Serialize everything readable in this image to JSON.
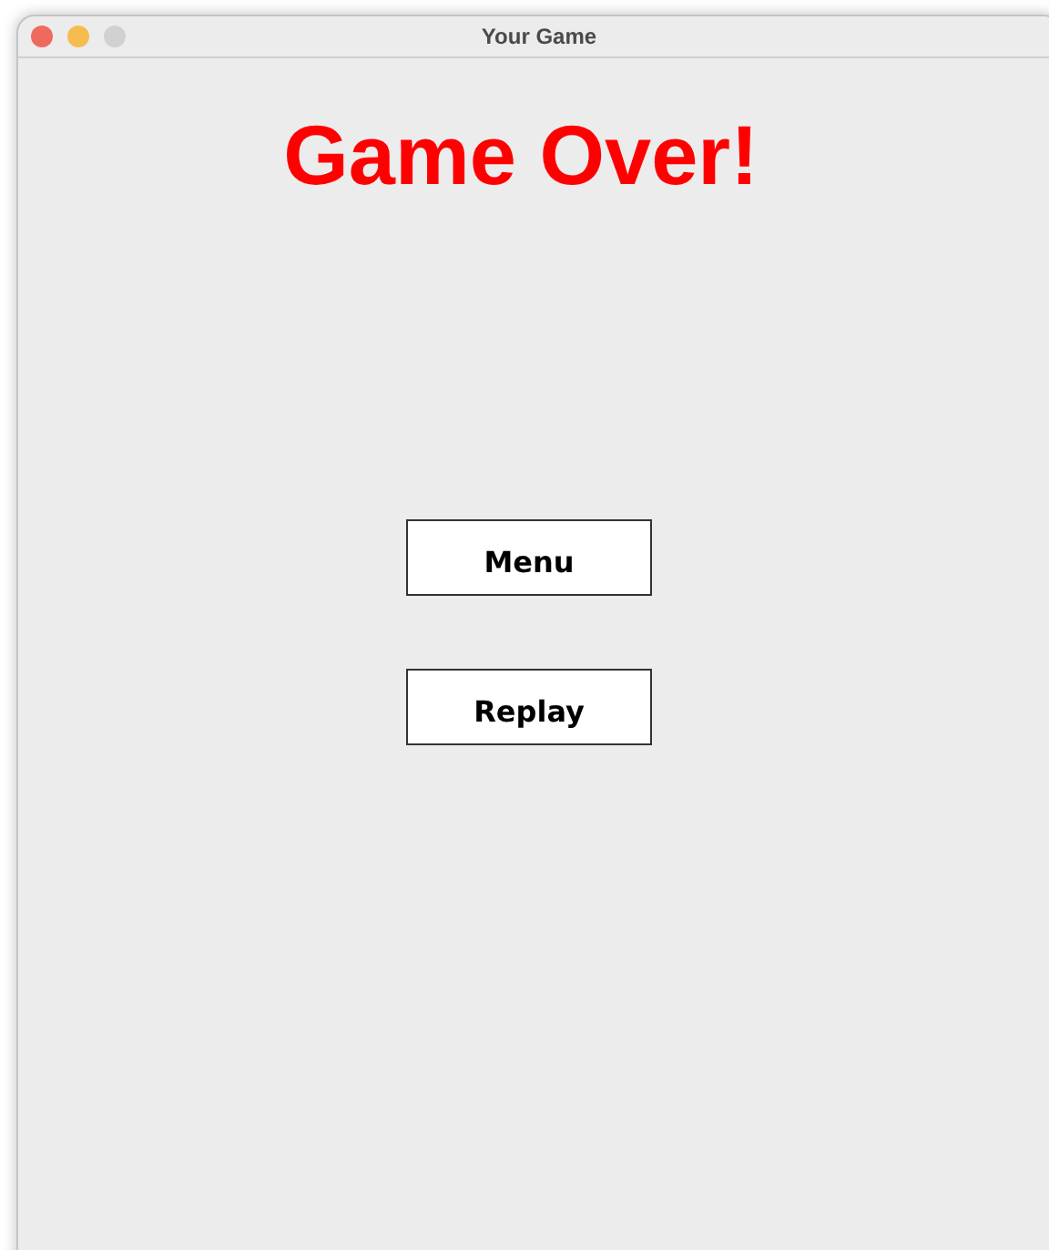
{
  "window": {
    "title": "Your Game"
  },
  "heading": "Game Over!",
  "buttons": [
    {
      "label": "Menu"
    },
    {
      "label": "Replay"
    }
  ]
}
